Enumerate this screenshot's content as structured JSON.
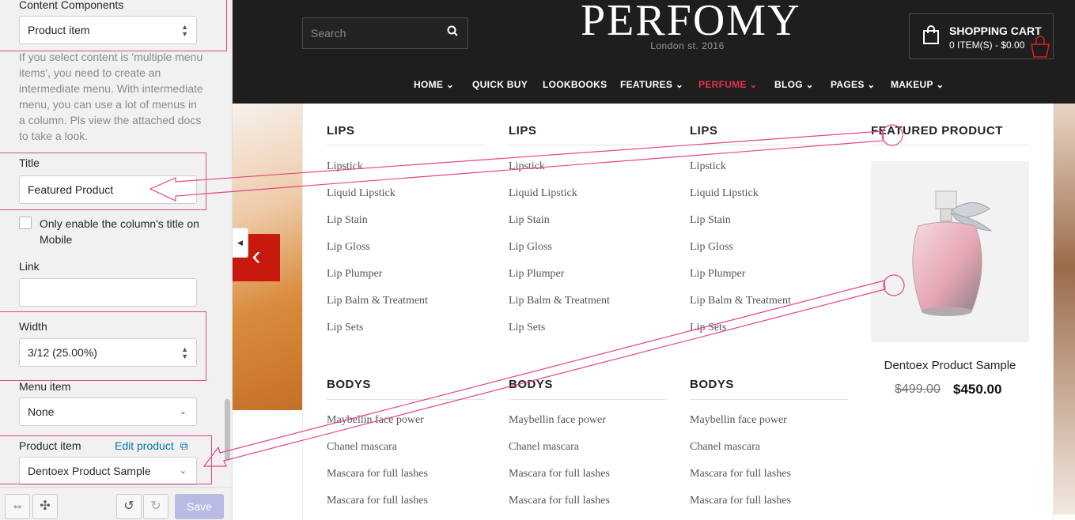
{
  "panel": {
    "content_components_label": "Content Components",
    "content_components_value": "Product item",
    "help_text": "If you select content is 'multiple menu items', you need to create an intermediate menu. With intermediate menu, you can use a lot of menus in a column. Pls view the attached docs to take a look.",
    "title_label": "Title",
    "title_value": "Featured Product",
    "mobile_title_label": "Only enable the column's title on Mobile",
    "link_label": "Link",
    "link_value": "",
    "width_label": "Width",
    "width_value": "3/12 (25.00%)",
    "menu_item_label": "Menu item",
    "menu_item_value": "None",
    "product_item_label": "Product item",
    "edit_product_label": "Edit product",
    "product_item_value": "Dentoex Product Sample",
    "save_label": "Save"
  },
  "header": {
    "search_placeholder": "Search",
    "logo": "PERFOMY",
    "tagline": "London st. 2016",
    "cart_title": "SHOPPING CART",
    "cart_summary": "0 ITEM(S) - $0.00",
    "nav": [
      {
        "label": "HOME",
        "dropdown": true
      },
      {
        "label": "QUICK BUY",
        "dropdown": false
      },
      {
        "label": "LOOKBOOKS",
        "dropdown": false
      },
      {
        "label": "FEATURES",
        "dropdown": true
      },
      {
        "label": "PERFUME",
        "dropdown": true,
        "active": true
      },
      {
        "label": "BLOG",
        "dropdown": true
      },
      {
        "label": "PAGES",
        "dropdown": true
      },
      {
        "label": "MAKEUP",
        "dropdown": true
      }
    ],
    "accent_color": "#e4314f"
  },
  "mega_menu": {
    "columns": [
      {
        "title": "LIPS",
        "links": [
          "Lipstick",
          "Liquid Lipstick",
          "Lip Stain",
          "Lip Gloss",
          "Lip Plumper",
          "Lip Balm & Treatment",
          "Lip Sets"
        ],
        "title2": "BODYS",
        "links2": [
          "Maybellin face power",
          "Chanel mascara",
          "Mascara for full lashes",
          "Mascara for full lashes"
        ]
      },
      {
        "title": "LIPS",
        "links": [
          "Lipstick",
          "Liquid Lipstick",
          "Lip Stain",
          "Lip Gloss",
          "Lip Plumper",
          "Lip Balm & Treatment",
          "Lip Sets"
        ],
        "title2": "BODYS",
        "links2": [
          "Maybellin face power",
          "Chanel mascara",
          "Mascara for full lashes",
          "Mascara for full lashes"
        ]
      },
      {
        "title": "LIPS",
        "links": [
          "Lipstick",
          "Liquid Lipstick",
          "Lip Stain",
          "Lip Gloss",
          "Lip Plumper",
          "Lip Balm & Treatment",
          "Lip Sets"
        ],
        "title2": "BODYS",
        "links2": [
          "Maybellin face power",
          "Chanel mascara",
          "Mascara for full lashes",
          "Mascara for full lashes"
        ]
      }
    ],
    "featured": {
      "title": "FEATURED PRODUCT",
      "product_name": "Dentoex Product Sample",
      "old_price": "$499.00",
      "new_price": "$450.00"
    }
  },
  "annotation_color": "#e1468a"
}
